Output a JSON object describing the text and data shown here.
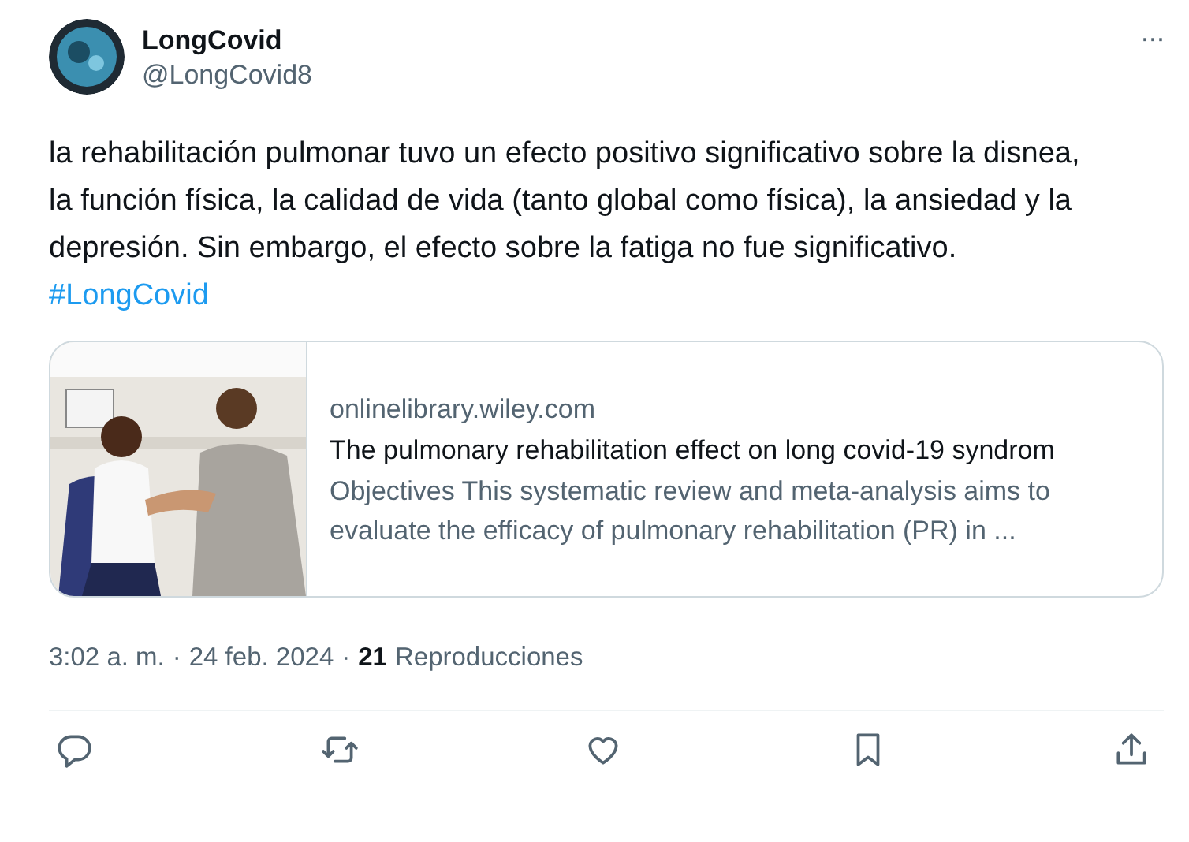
{
  "author": {
    "name": "LongCovid",
    "handle": "@LongCovid8"
  },
  "more_button": "···",
  "text": "la rehabilitación pulmonar tuvo un efecto positivo significativo sobre la disnea, la función física, la calidad de vida (tanto global como física), la ansiedad y la depresión. Sin embargo, el efecto sobre la fatiga no fue significativo.",
  "hashtag": "#LongCovid",
  "link_card": {
    "domain": "onlinelibrary.wiley.com",
    "title": "The pulmonary rehabilitation effect on long covid-19 syndrom",
    "description": "Objectives This systematic review and meta-analysis aims to evaluate the efficacy of pulmonary rehabilitation (PR) in ..."
  },
  "meta": {
    "time": "3:02 a. m.",
    "separator_1": "·",
    "date": "24 feb. 2024",
    "separator_2": "·",
    "views": "21",
    "views_label": "Reproducciones"
  },
  "actions": [
    {
      "kind": "reply"
    },
    {
      "kind": "repost"
    },
    {
      "kind": "like"
    },
    {
      "kind": "bookmark"
    },
    {
      "kind": "share"
    }
  ]
}
